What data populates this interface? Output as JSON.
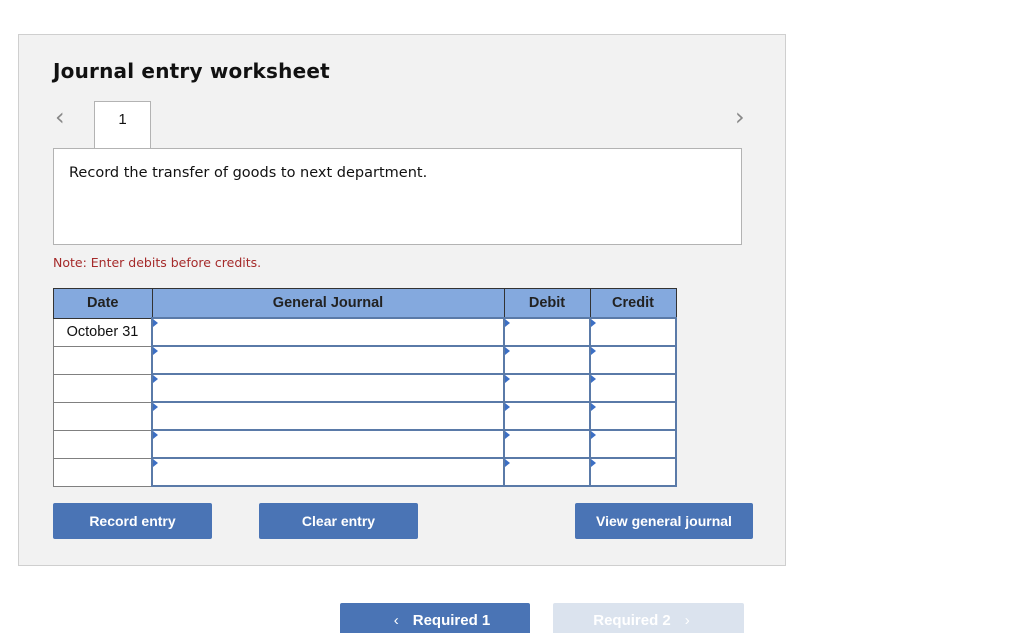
{
  "worksheet": {
    "title": "Journal entry worksheet",
    "nav_prev_icon": "‹",
    "nav_next_icon": "›",
    "tabs": [
      {
        "label": "1"
      }
    ],
    "instruction": "Record the transfer of goods to next department.",
    "note": "Note: Enter debits before credits."
  },
  "table": {
    "headers": {
      "date": "Date",
      "general_journal": "General Journal",
      "debit": "Debit",
      "credit": "Credit"
    },
    "rows": [
      {
        "date": "October 31",
        "account": "",
        "debit": "",
        "credit": ""
      },
      {
        "date": "",
        "account": "",
        "debit": "",
        "credit": ""
      },
      {
        "date": "",
        "account": "",
        "debit": "",
        "credit": ""
      },
      {
        "date": "",
        "account": "",
        "debit": "",
        "credit": ""
      },
      {
        "date": "",
        "account": "",
        "debit": "",
        "credit": ""
      },
      {
        "date": "",
        "account": "",
        "debit": "",
        "credit": ""
      }
    ]
  },
  "buttons": {
    "record": "Record entry",
    "clear": "Clear entry",
    "view": "View general journal"
  },
  "footer_nav": {
    "prev_label": "Required 1",
    "prev_icon": "‹",
    "next_label": "Required 2",
    "next_icon": "›"
  },
  "colors": {
    "button": "#4a74b5",
    "header": "#84a9de",
    "note": "#a52a2a",
    "disabled": "#dbe3ee"
  }
}
